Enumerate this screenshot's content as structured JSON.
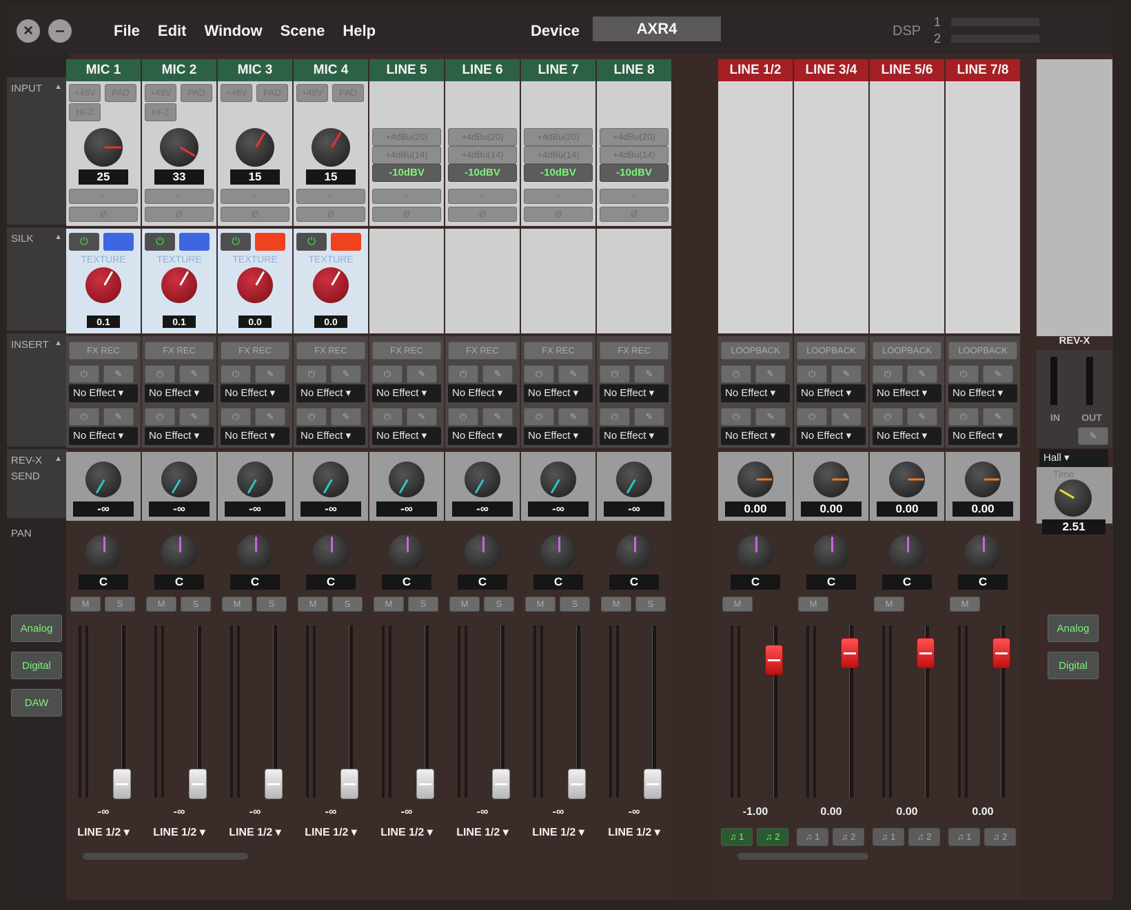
{
  "titlebar": {
    "menu": [
      "File",
      "Edit",
      "Window",
      "Scene",
      "Help"
    ],
    "device_label": "Device",
    "device_value": "AXR4",
    "dsp_label": "DSP",
    "dsp_1": "1",
    "dsp_2": "2"
  },
  "sections": {
    "input": "INPUT",
    "silk": "SILK",
    "insert": "INSERT",
    "revx_1": "REV-X",
    "revx_2": "SEND",
    "pan": "PAN"
  },
  "sidebar_buttons": {
    "analog": "Analog",
    "digital": "Digital",
    "daw": "DAW"
  },
  "mic_channels": [
    {
      "name": "MIC 1",
      "gain": "25",
      "silk_value": "0.1",
      "silk_color": "blue"
    },
    {
      "name": "MIC 2",
      "gain": "33",
      "silk_value": "0.1",
      "silk_color": "blue"
    },
    {
      "name": "MIC 3",
      "gain": "15",
      "silk_value": "0.0",
      "silk_color": "red"
    },
    {
      "name": "MIC 4",
      "gain": "15",
      "silk_value": "0.0",
      "silk_color": "red"
    }
  ],
  "line_channels": [
    {
      "name": "LINE 5"
    },
    {
      "name": "LINE 6"
    },
    {
      "name": "LINE 7"
    },
    {
      "name": "LINE 8"
    }
  ],
  "labels": {
    "phantom": "+48V",
    "pad": "PAD",
    "hiz": "HI-Z",
    "texture": "TEXTURE",
    "line_lvl_1": "+4dBu(20)",
    "line_lvl_2": "+4dBu(14)",
    "line_lvl_3": "-10dBV",
    "fxrec": "FX REC",
    "loopback": "LOOPBACK",
    "no_effect": "No Effect",
    "send_value": "-∞",
    "pan_value": "C",
    "mute": "M",
    "solo": "S",
    "fader_value": "-∞",
    "output": "LINE 1/2"
  },
  "stereo_channels": [
    {
      "name": "LINE 1/2",
      "send": "0.00",
      "fader": "-1.00",
      "fader_level": 0.8,
      "out_a": "1",
      "out_b": "2",
      "outs_active": true
    },
    {
      "name": "LINE 3/4",
      "send": "0.00",
      "fader": "0.00",
      "fader_level": 0.84,
      "out_a": "1",
      "out_b": "2",
      "outs_active": false
    },
    {
      "name": "LINE 5/6",
      "send": "0.00",
      "fader": "0.00",
      "fader_level": 0.84,
      "out_a": "1",
      "out_b": "2",
      "outs_active": false
    },
    {
      "name": "LINE 7/8",
      "send": "0.00",
      "fader": "0.00",
      "fader_level": 0.84,
      "out_a": "1",
      "out_b": "2",
      "outs_active": false
    }
  ],
  "revx": {
    "title": "REV-X",
    "in": "IN",
    "out": "OUT",
    "type": "Hall",
    "time_label": "Time",
    "time_value": "2.51",
    "analog": "Analog",
    "digital": "Digital"
  },
  "colors": {
    "mic_header": "#2d6146",
    "stereo_header": "#a51f24",
    "silk_blue": "#3d66e0",
    "silk_red": "#f0421f",
    "silk_knob": "#a8202a",
    "green_text": "#7ff07f"
  }
}
